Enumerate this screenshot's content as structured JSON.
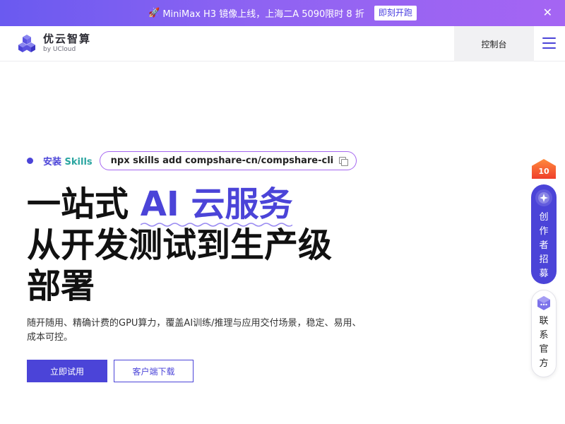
{
  "announcement": {
    "rocket": "🚀",
    "text": "MiniMax H3 镜像上线，上海二A 5090限时 8 折",
    "cta": "即刻开跑",
    "close": "✕"
  },
  "header": {
    "logo_main": "优云智算",
    "logo_sub": "by UCloud",
    "console": "控制台"
  },
  "hero": {
    "skills_prefix": "安装 ",
    "skills_word": "Skills",
    "command": "npx skills add compshare-cn/compshare-cli",
    "headline_pre": "一站式 ",
    "headline_accent": "AI 云服务",
    "headline_line2": "从开发测试到生产级",
    "headline_line3": "部署",
    "description": "随开随用、精确计费的GPU算力，覆盖AI训练/推理与应用交付场景，稳定、易用、成本可控。",
    "primary_button": "立即试用",
    "secondary_button": "客户端下载"
  },
  "side": {
    "badge": "10",
    "creator_chars": [
      "创",
      "作",
      "者",
      "招",
      "募"
    ],
    "contact_chars": [
      "联",
      "系",
      "官",
      "方"
    ]
  },
  "colors": {
    "accent": "#4b44d8",
    "skills_teal": "#2aa5a0",
    "pill_border": "#a566f0",
    "badge_orange": "#ef3f2b"
  }
}
